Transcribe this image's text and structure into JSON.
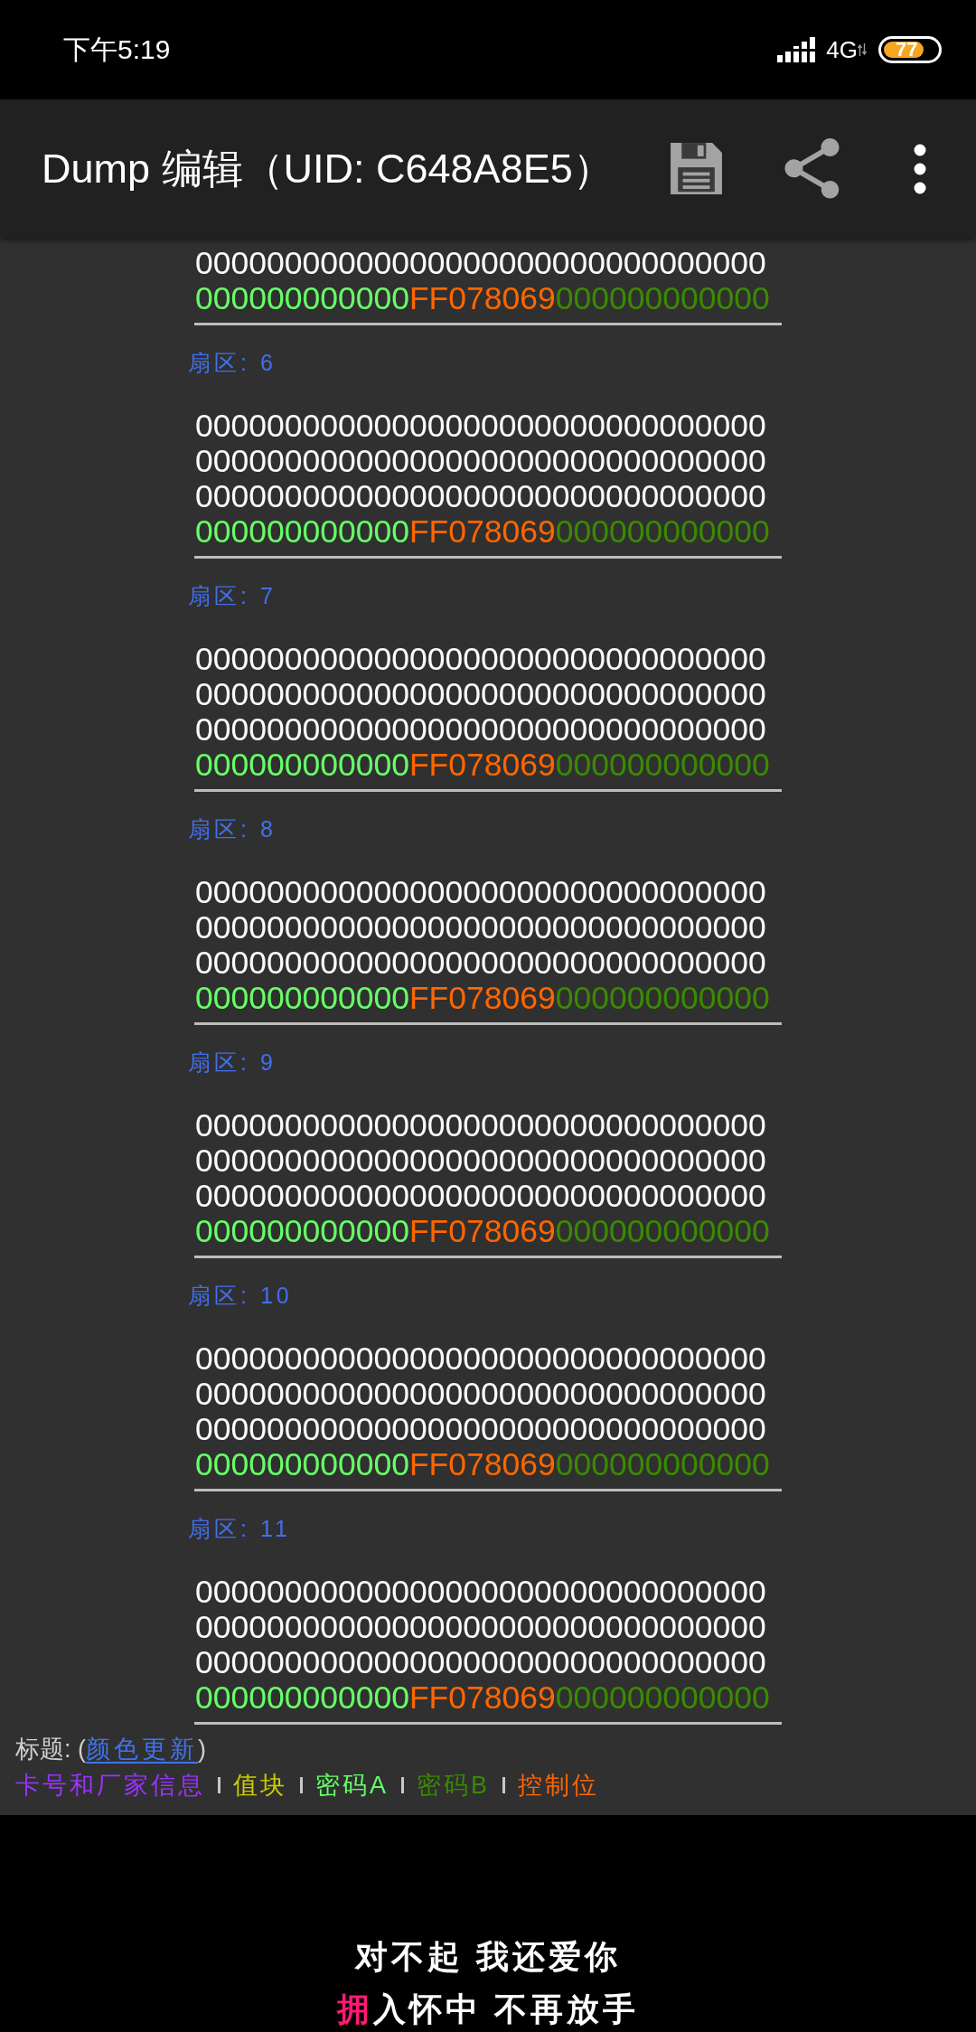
{
  "status_bar": {
    "time": "下午5:19",
    "network": "4G",
    "battery": "77"
  },
  "toolbar": {
    "title": "Dump 编辑（UID: C648A8E5）"
  },
  "sectors": [
    {
      "blocks": [
        {
          "kind": "data",
          "text": "00000000000000000000000000000000"
        },
        {
          "kind": "trailer",
          "parts": [
            {
              "kind": "key_a",
              "text": "000000000000"
            },
            {
              "kind": "access_bits",
              "text": "FF078069"
            },
            {
              "kind": "key_b",
              "text": "000000000000"
            }
          ]
        }
      ]
    },
    {
      "title": "扇区: 6",
      "blocks": [
        {
          "kind": "data",
          "text": "00000000000000000000000000000000"
        },
        {
          "kind": "data",
          "text": "00000000000000000000000000000000"
        },
        {
          "kind": "data",
          "text": "00000000000000000000000000000000"
        },
        {
          "kind": "trailer",
          "parts": [
            {
              "kind": "key_a",
              "text": "000000000000"
            },
            {
              "kind": "access_bits",
              "text": "FF078069"
            },
            {
              "kind": "key_b",
              "text": "000000000000"
            }
          ]
        }
      ]
    },
    {
      "title": "扇区: 7",
      "blocks": [
        {
          "kind": "data",
          "text": "00000000000000000000000000000000"
        },
        {
          "kind": "data",
          "text": "00000000000000000000000000000000"
        },
        {
          "kind": "data",
          "text": "00000000000000000000000000000000"
        },
        {
          "kind": "trailer",
          "parts": [
            {
              "kind": "key_a",
              "text": "000000000000"
            },
            {
              "kind": "access_bits",
              "text": "FF078069"
            },
            {
              "kind": "key_b",
              "text": "000000000000"
            }
          ]
        }
      ]
    },
    {
      "title": "扇区: 8",
      "blocks": [
        {
          "kind": "data",
          "text": "00000000000000000000000000000000"
        },
        {
          "kind": "data",
          "text": "00000000000000000000000000000000"
        },
        {
          "kind": "data",
          "text": "00000000000000000000000000000000"
        },
        {
          "kind": "trailer",
          "parts": [
            {
              "kind": "key_a",
              "text": "000000000000"
            },
            {
              "kind": "access_bits",
              "text": "FF078069"
            },
            {
              "kind": "key_b",
              "text": "000000000000"
            }
          ]
        }
      ]
    },
    {
      "title": "扇区: 9",
      "blocks": [
        {
          "kind": "data",
          "text": "00000000000000000000000000000000"
        },
        {
          "kind": "data",
          "text": "00000000000000000000000000000000"
        },
        {
          "kind": "data",
          "text": "00000000000000000000000000000000"
        },
        {
          "kind": "trailer",
          "parts": [
            {
              "kind": "key_a",
              "text": "000000000000"
            },
            {
              "kind": "access_bits",
              "text": "FF078069"
            },
            {
              "kind": "key_b",
              "text": "000000000000"
            }
          ]
        }
      ]
    },
    {
      "title": "扇区: 10",
      "blocks": [
        {
          "kind": "data",
          "text": "00000000000000000000000000000000"
        },
        {
          "kind": "data",
          "text": "00000000000000000000000000000000"
        },
        {
          "kind": "data",
          "text": "00000000000000000000000000000000"
        },
        {
          "kind": "trailer",
          "parts": [
            {
              "kind": "key_a",
              "text": "000000000000"
            },
            {
              "kind": "access_bits",
              "text": "FF078069"
            },
            {
              "kind": "key_b",
              "text": "000000000000"
            }
          ]
        }
      ]
    },
    {
      "title": "扇区: 11",
      "blocks": [
        {
          "kind": "data",
          "text": "00000000000000000000000000000000"
        },
        {
          "kind": "data",
          "text": "00000000000000000000000000000000"
        },
        {
          "kind": "data",
          "text": "00000000000000000000000000000000"
        },
        {
          "kind": "trailer",
          "parts": [
            {
              "kind": "key_a",
              "text": "000000000000"
            },
            {
              "kind": "access_bits",
              "text": "FF078069"
            },
            {
              "kind": "key_b",
              "text": "000000000000"
            }
          ]
        }
      ]
    }
  ],
  "legend": {
    "prefix": "标题: (",
    "link": "颜色更新",
    "suffix": ")",
    "items": [
      {
        "kind": "manufacturer",
        "text": "卡号和厂家信息",
        "color": "#9933ff"
      },
      {
        "kind": "value",
        "text": "值块",
        "color": "#cccc00"
      },
      {
        "kind": "key_a",
        "text": "密码A",
        "color": "#66ff66"
      },
      {
        "kind": "key_b",
        "text": "密码B",
        "color": "#3a8a00"
      },
      {
        "kind": "access_bits",
        "text": "控制位",
        "color": "#ff6600"
      }
    ]
  },
  "lyrics": [
    {
      "text": "对不起 我还爱你"
    },
    {
      "sung": "拥",
      "text": "入怀中 不再放手"
    }
  ]
}
